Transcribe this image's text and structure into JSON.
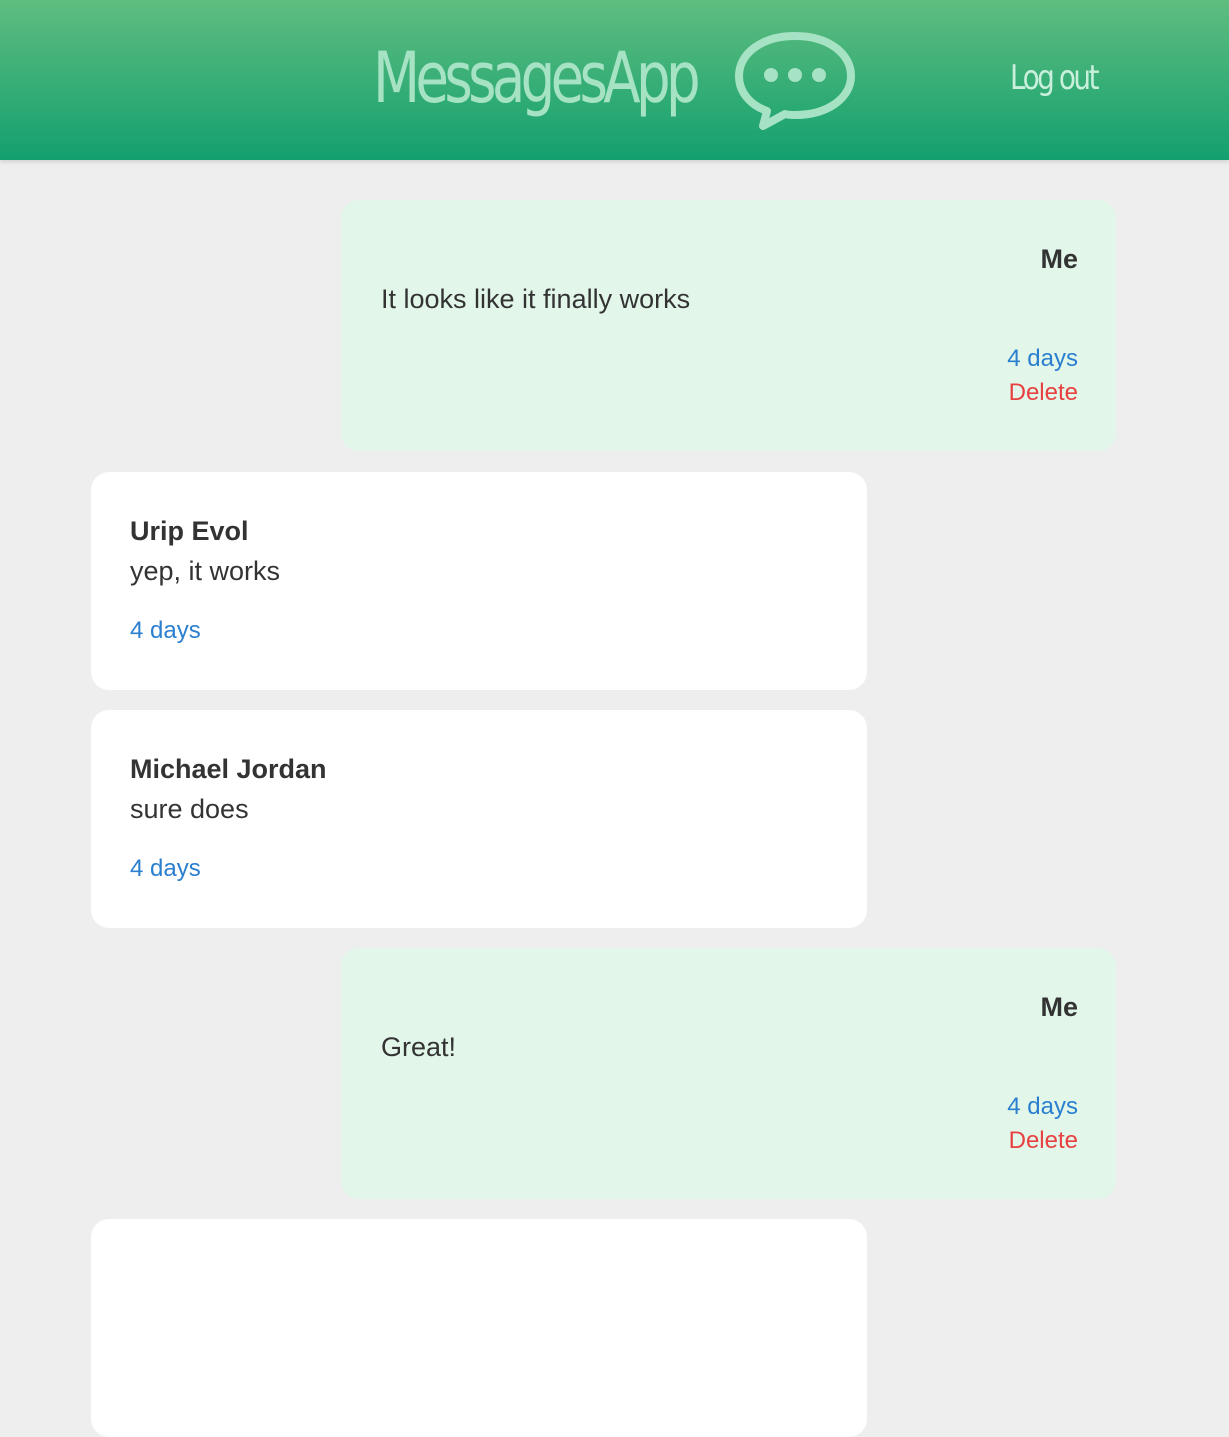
{
  "header": {
    "app_title": "MessagesApp",
    "logout_label": "Log out",
    "colors": {
      "gradient_top": "#5fbd7f",
      "gradient_bottom": "#13a06f",
      "title": "#a6e2c4"
    },
    "icon": "speech-bubble-icon"
  },
  "messages": [
    {
      "sender": "Me",
      "text": "It looks like it finally works",
      "time": "4 days",
      "delete_label": "Delete",
      "own": true
    },
    {
      "sender": "Urip Evol",
      "text": "yep, it works",
      "time": "4 days",
      "own": false
    },
    {
      "sender": "Michael Jordan",
      "text": "sure does",
      "time": "4 days",
      "own": false
    },
    {
      "sender": "Me",
      "text": "Great!",
      "time": "4 days",
      "delete_label": "Delete",
      "own": true
    }
  ],
  "colors": {
    "own_bubble": "#e2f7ea",
    "other_bubble": "#ffffff",
    "page_background": "#eeeeee",
    "time_link": "#2a7fcf",
    "delete_link": "#e84040",
    "text": "#333333"
  }
}
